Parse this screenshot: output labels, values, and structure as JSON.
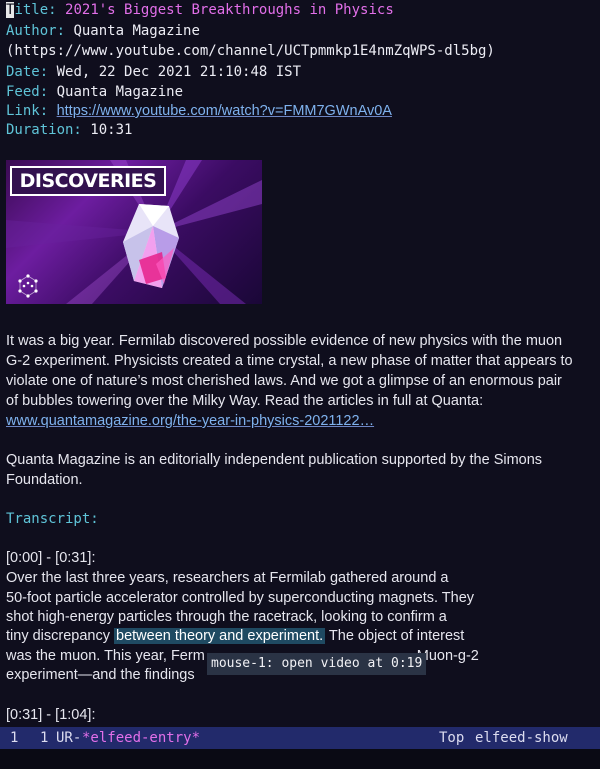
{
  "header": {
    "title_key": "Title:",
    "title_value": "2021's Biggest Breakthroughs in Physics",
    "author_key": "Author:",
    "author_value": "Quanta Magazine",
    "author_url": "(https://www.youtube.com/channel/UCTpmmkp1E4nmZqWPS-dl5bg)",
    "date_key": "Date:",
    "date_value": "Wed, 22 Dec 2021 21:10:48 IST",
    "feed_key": "Feed:",
    "feed_value": "Quanta Magazine",
    "link_key": "Link:",
    "link_value": "https://www.youtube.com/watch?v=FMM7GWnAv0A",
    "duration_key": "Duration:",
    "duration_value": "10:31"
  },
  "thumbnail": {
    "label": "DISCOVERIES",
    "icon": "atom-logo-icon"
  },
  "description": {
    "lines": [
      "It was a big year. Fermilab discovered possible evidence of new physics with the muon",
      "G-2 experiment. Physicists created a time crystal, a new phase of matter that appears to",
      "violate one of nature’s most cherished laws. And we got a glimpse of an enormous pair",
      "of bubbles towering over the Milky Way. Read the articles in full at Quanta:"
    ],
    "link": "www.quantamagazine.org/the-year-in-physics-2021122…",
    "note_lines": [
      "Quanta Magazine is an editorially independent publication supported by the Simons",
      "Foundation."
    ]
  },
  "transcript": {
    "heading": "Transcript:",
    "segment1": {
      "timestamp": "[0:00] - [0:31]:",
      "line1": "Over the last three years, researchers at Fermilab gathered around  a",
      "line2": "50-foot particle accelerator controlled by superconducting magnets.  They",
      "line3": "shot high-energy particles through the racetrack, looking to confirm a",
      "line4_pre": "tiny discrepancy ",
      "line4_highlight": "between theory and experiment.",
      "line4_post": "  The object of interest",
      "line5_pre": "was the muon.  This year, Ferm",
      "line5_post": "Muon-g-2",
      "line6": "experiment—and the findings"
    },
    "segment2_timestamp": "[0:31] - [1:04]:"
  },
  "tooltip": "mouse-1: open video at 0:19",
  "modeline": {
    "column": "1",
    "line": "1",
    "status": "UR-",
    "buffer": "*elfeed-entry*",
    "position": "Top",
    "mode": "elfeed-show"
  },
  "colors": {
    "background": "#0f0e1d",
    "key": "#5fc4d8",
    "title": "#e26fe9",
    "link": "#7fb2ee",
    "highlight": "#1f4a62",
    "modeline": "#222a6b"
  }
}
